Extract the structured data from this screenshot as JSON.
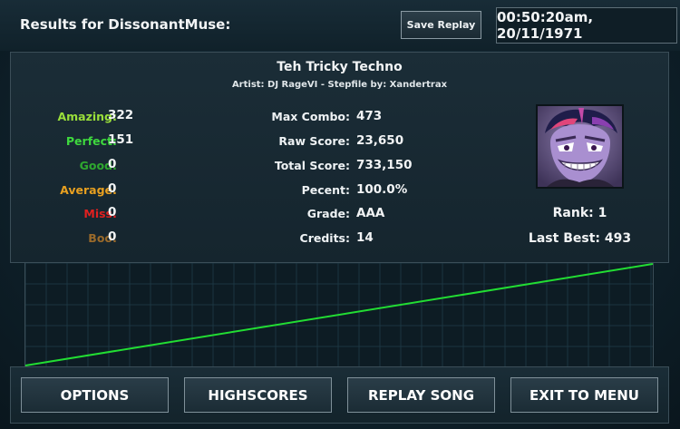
{
  "header": {
    "results_title": "Results for DissonantMuse:",
    "save_replay_label": "Save Replay",
    "timestamp": "00:50:20am, 20/11/1971"
  },
  "song": {
    "title": "Teh Tricky Techno",
    "credits_line": "Artist: DJ RageVI  -  Stepfile by: Xandertrax"
  },
  "judgements": [
    {
      "label": "Amazing:",
      "value": "322",
      "color": "#9adf3a"
    },
    {
      "label": "Perfect:",
      "value": "151",
      "color": "#3ed83e"
    },
    {
      "label": "Good:",
      "value": "0",
      "color": "#2fa82f"
    },
    {
      "label": "Average:",
      "value": "0",
      "color": "#e8a020"
    },
    {
      "label": "Miss:",
      "value": "0",
      "color": "#e02020"
    },
    {
      "label": "Boo:",
      "value": "0",
      "color": "#9a6a2a"
    }
  ],
  "stats": [
    {
      "label": "Max Combo:",
      "value": "473"
    },
    {
      "label": "Raw Score:",
      "value": "23,650"
    },
    {
      "label": "Total Score:",
      "value": "733,150"
    },
    {
      "label": "Pecent:",
      "value": "100.0%"
    },
    {
      "label": "Grade:",
      "value": "AAA"
    },
    {
      "label": "Credits:",
      "value": "14"
    }
  ],
  "player": {
    "avatar": "grinning-pony-avatar",
    "rank_text": "Rank: 1",
    "last_best_text": "Last Best: 493"
  },
  "graph": {
    "line_color": "#22dd33",
    "grid_color": "#1c3541",
    "trend": "steady-rise"
  },
  "buttons": {
    "options": "OPTIONS",
    "highscores": "HIGHSCORES",
    "replay_song": "REPLAY SONG",
    "exit_to_menu": "EXIT TO MENU"
  }
}
